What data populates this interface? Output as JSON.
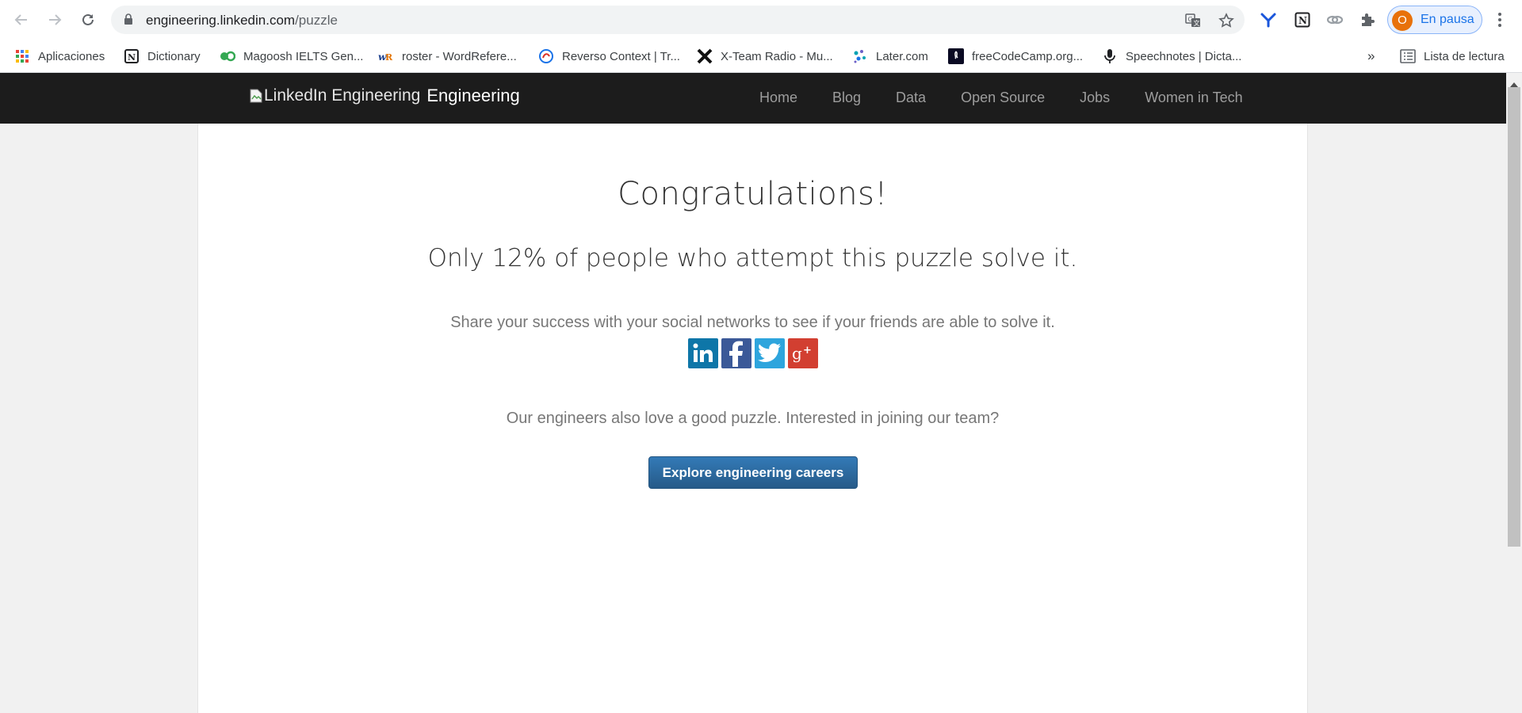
{
  "browser": {
    "url_host": "engineering.linkedin.com",
    "url_path": "/puzzle",
    "profile_initial": "O",
    "profile_status": "En pausa",
    "bookmarks": [
      {
        "label": "Aplicaciones",
        "icon": "apps-grid-icon"
      },
      {
        "label": "Dictionary",
        "icon": "notion-icon"
      },
      {
        "label": "Magoosh IELTS Gen...",
        "icon": "magoosh-icon"
      },
      {
        "label": "roster - WordRefere...",
        "icon": "wordreference-icon"
      },
      {
        "label": "Reverso Context | Tr...",
        "icon": "reverso-icon"
      },
      {
        "label": "X-Team Radio - Mu...",
        "icon": "x-team-icon"
      },
      {
        "label": "Later.com",
        "icon": "later-icon"
      },
      {
        "label": "freeCodeCamp.org...",
        "icon": "freecodecamp-icon"
      },
      {
        "label": "Speechnotes | Dicta...",
        "icon": "microphone-icon"
      }
    ],
    "bookmarks_overflow": "»",
    "reading_list": "Lista de lectura"
  },
  "site": {
    "logo_alt": "LinkedIn Engineering",
    "brand_text": "Engineering",
    "nav": [
      "Home",
      "Blog",
      "Data",
      "Open Source",
      "Jobs",
      "Women in Tech"
    ]
  },
  "main": {
    "heading": "Congratulations!",
    "stat_text": "Only 12% of people who attempt this puzzle solve it.",
    "share_text": "Share your success with your social networks to see if your friends are able to solve it.",
    "social": [
      {
        "name": "linkedin",
        "color": "#0e76a8"
      },
      {
        "name": "facebook",
        "color": "#3b5998"
      },
      {
        "name": "twitter",
        "color": "#2ea5dd"
      },
      {
        "name": "google-plus",
        "color": "#d23f31"
      }
    ],
    "team_text": "Our engineers also love a good puzzle. Interested in joining our team?",
    "cta_label": "Explore engineering careers"
  },
  "colors": {
    "header_bg": "#1c1c1c",
    "button_bg": "#2e6da4",
    "profile_avatar": "#e8710a"
  }
}
